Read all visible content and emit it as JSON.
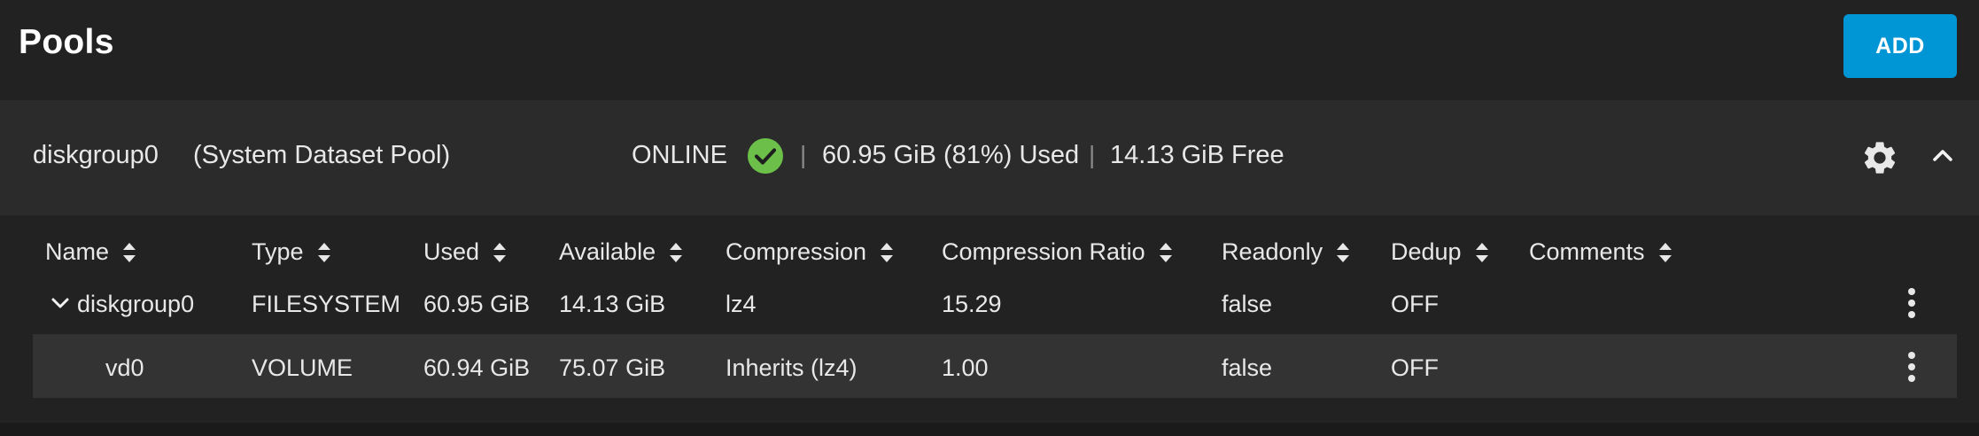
{
  "page": {
    "title": "Pools",
    "add_label": "ADD"
  },
  "pool": {
    "name": "diskgroup0",
    "system_dataset_label": "(System Dataset Pool)",
    "status": "ONLINE",
    "separator": "|",
    "used": "60.95 GiB (81%) Used",
    "free": "14.13 GiB Free",
    "status_color": "#6cc04a"
  },
  "table": {
    "columns": [
      {
        "label": "Name"
      },
      {
        "label": "Type"
      },
      {
        "label": "Used"
      },
      {
        "label": "Available"
      },
      {
        "label": "Compression"
      },
      {
        "label": "Compression Ratio"
      },
      {
        "label": "Readonly"
      },
      {
        "label": "Dedup"
      },
      {
        "label": "Comments"
      }
    ],
    "rows": [
      {
        "name": "diskgroup0",
        "type": "FILESYSTEM",
        "used": "60.95 GiB",
        "available": "14.13 GiB",
        "compression": "lz4",
        "compression_ratio": "15.29",
        "readonly": "false",
        "dedup": "OFF",
        "comments": ""
      },
      {
        "name": "vd0",
        "type": "VOLUME",
        "used": "60.94 GiB",
        "available": "75.07 GiB",
        "compression": "Inherits (lz4)",
        "compression_ratio": "1.00",
        "readonly": "false",
        "dedup": "OFF",
        "comments": ""
      }
    ]
  },
  "icons": {
    "status": "check-circle-icon",
    "settings": "gear-icon",
    "collapse": "chevron-up-icon",
    "expand": "chevron-down-icon",
    "row_actions": "kebab-menu-icon",
    "sort": "sort-icon"
  },
  "colors": {
    "accent": "#0095d5",
    "background": "#222222",
    "card": "#2b2b2b",
    "row_highlight": "#333333"
  }
}
